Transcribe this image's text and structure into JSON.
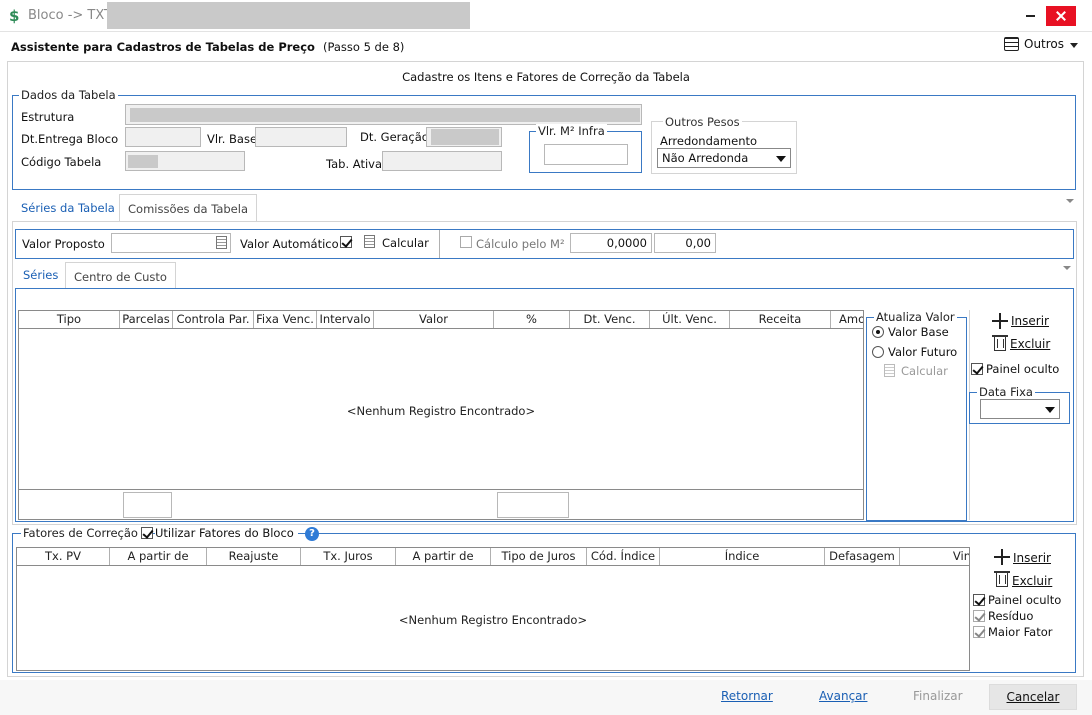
{
  "window": {
    "title": "Bloco -> TXT"
  },
  "header": {
    "title": "Assistente para Cadastros de Tabelas de Preço",
    "step": "(Passo 5 de 8)",
    "outros_label": "Outros"
  },
  "instructions": "Cadastre os Itens e Fatores de Correção da Tabela",
  "dados": {
    "legend": "Dados da Tabela",
    "estrutura_label": "Estrutura",
    "dt_entrega_label": "Dt.Entrega Bloco",
    "vlr_base_label": "Vlr. Base",
    "dt_geracao_label": "Dt. Geração",
    "codigo_label": "Código Tabela",
    "tab_ativa_label": "Tab. Ativa",
    "vlr_m2_legend": "Vlr. M² Infra",
    "outros_pesos_legend": "Outros Pesos",
    "arredondamento_label": "Arredondamento",
    "arredondamento_value": "Não Arredonda"
  },
  "tabs": [
    {
      "label": "Séries da Tabela"
    },
    {
      "label": "Comissões da Tabela"
    }
  ],
  "valor": {
    "proposto_label": "Valor Proposto",
    "automatico_label": "Valor Automático",
    "calcular_label": "Calcular",
    "calculo_m2_label": "Cálculo pelo M²",
    "field1": "0,0000",
    "field2": "0,00"
  },
  "subtabs": [
    {
      "label": "Séries"
    },
    {
      "label": "Centro de Custo"
    }
  ],
  "series_grid": {
    "columns": [
      "Tipo",
      "Parcelas",
      "Controla Par.",
      "Fixa Venc.",
      "Intervalo",
      "Valor",
      "%",
      "Dt. Venc.",
      "Últ. Venc.",
      "Receita",
      "Amo"
    ],
    "empty": "<Nenhum Registro Encontrado>"
  },
  "atualiza": {
    "legend": "Atualiza Valor",
    "valor_base": "Valor Base",
    "valor_futuro": "Valor Futuro",
    "calcular": "Calcular"
  },
  "series_actions": {
    "inserir": "Inserir",
    "excluir": "Excluir",
    "painel_oculto": "Painel oculto",
    "data_fixa_legend": "Data Fixa"
  },
  "fatores": {
    "legend": "Fatores de Correção",
    "utilizar_label": "Utilizar Fatores do Bloco",
    "help": "?",
    "columns": [
      "Tx. PV",
      "A partir de",
      "Reajuste",
      "Tx. Juros",
      "A partir de",
      "Tipo de Juros",
      "Cód. Índice",
      "Índice",
      "Defasagem",
      "Vin"
    ],
    "empty": "<Nenhum Registro Encontrado>",
    "inserir": "Inserir",
    "excluir": "Excluir",
    "painel_oculto": "Painel oculto",
    "residuo": "Resíduo",
    "maior_fator": "Maior Fator"
  },
  "footer": {
    "retornar": "Retornar",
    "avancar": "Avançar",
    "finalizar": "Finalizar",
    "cancelar": "Cancelar"
  }
}
